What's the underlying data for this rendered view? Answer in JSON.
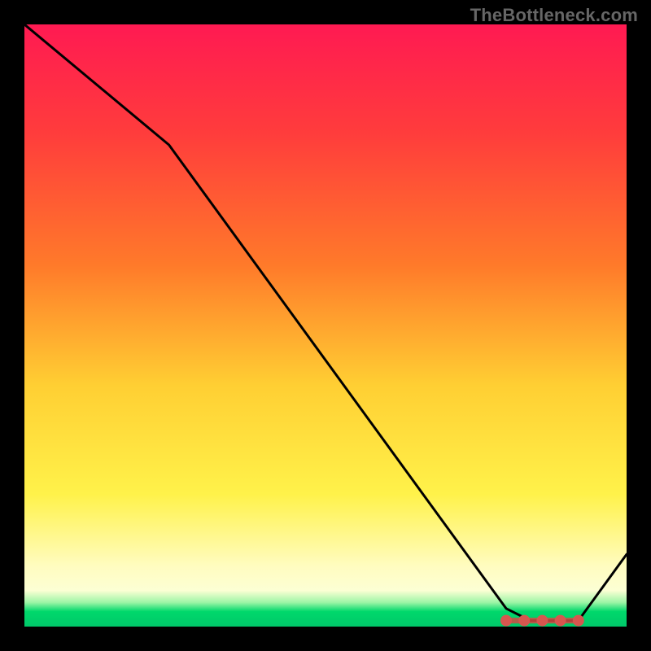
{
  "watermark": "TheBottleneck.com",
  "chart_data": {
    "type": "line",
    "title": "",
    "xlabel": "",
    "ylabel": "",
    "xlim": [
      0,
      100
    ],
    "ylim": [
      0,
      100
    ],
    "x": [
      0,
      24,
      80,
      84,
      88,
      92,
      100
    ],
    "values": [
      100,
      80,
      3,
      1,
      1,
      1,
      12
    ],
    "optimal_region_x": [
      80,
      92
    ],
    "background_gradient": {
      "stops": [
        {
          "pct": 0,
          "color": "#ff1a52"
        },
        {
          "pct": 60,
          "color": "#ffcf33"
        },
        {
          "pct": 90,
          "color": "#fffcc0"
        },
        {
          "pct": 97,
          "color": "#00d86b"
        },
        {
          "pct": 100,
          "color": "#00c86a"
        }
      ]
    }
  }
}
